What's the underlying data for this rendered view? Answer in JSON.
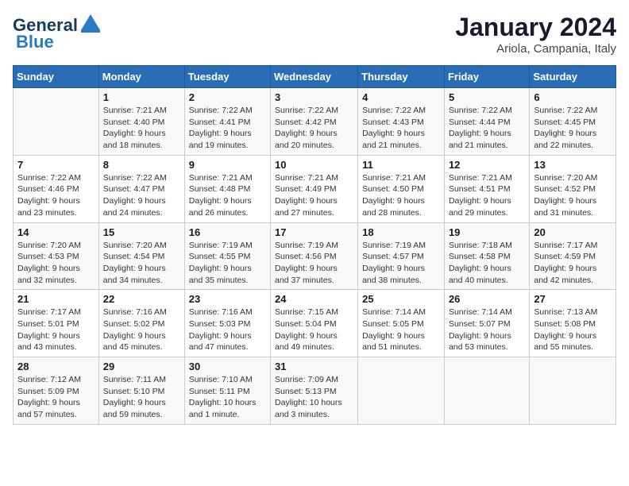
{
  "header": {
    "logo_line1": "General",
    "logo_line2": "Blue",
    "title": "January 2024",
    "subtitle": "Ariola, Campania, Italy"
  },
  "weekdays": [
    "Sunday",
    "Monday",
    "Tuesday",
    "Wednesday",
    "Thursday",
    "Friday",
    "Saturday"
  ],
  "weeks": [
    [
      {
        "date": "",
        "info": ""
      },
      {
        "date": "1",
        "info": "Sunrise: 7:21 AM\nSunset: 4:40 PM\nDaylight: 9 hours\nand 18 minutes."
      },
      {
        "date": "2",
        "info": "Sunrise: 7:22 AM\nSunset: 4:41 PM\nDaylight: 9 hours\nand 19 minutes."
      },
      {
        "date": "3",
        "info": "Sunrise: 7:22 AM\nSunset: 4:42 PM\nDaylight: 9 hours\nand 20 minutes."
      },
      {
        "date": "4",
        "info": "Sunrise: 7:22 AM\nSunset: 4:43 PM\nDaylight: 9 hours\nand 21 minutes."
      },
      {
        "date": "5",
        "info": "Sunrise: 7:22 AM\nSunset: 4:44 PM\nDaylight: 9 hours\nand 21 minutes."
      },
      {
        "date": "6",
        "info": "Sunrise: 7:22 AM\nSunset: 4:45 PM\nDaylight: 9 hours\nand 22 minutes."
      }
    ],
    [
      {
        "date": "7",
        "info": "Sunrise: 7:22 AM\nSunset: 4:46 PM\nDaylight: 9 hours\nand 23 minutes."
      },
      {
        "date": "8",
        "info": "Sunrise: 7:22 AM\nSunset: 4:47 PM\nDaylight: 9 hours\nand 24 minutes."
      },
      {
        "date": "9",
        "info": "Sunrise: 7:21 AM\nSunset: 4:48 PM\nDaylight: 9 hours\nand 26 minutes."
      },
      {
        "date": "10",
        "info": "Sunrise: 7:21 AM\nSunset: 4:49 PM\nDaylight: 9 hours\nand 27 minutes."
      },
      {
        "date": "11",
        "info": "Sunrise: 7:21 AM\nSunset: 4:50 PM\nDaylight: 9 hours\nand 28 minutes."
      },
      {
        "date": "12",
        "info": "Sunrise: 7:21 AM\nSunset: 4:51 PM\nDaylight: 9 hours\nand 29 minutes."
      },
      {
        "date": "13",
        "info": "Sunrise: 7:20 AM\nSunset: 4:52 PM\nDaylight: 9 hours\nand 31 minutes."
      }
    ],
    [
      {
        "date": "14",
        "info": "Sunrise: 7:20 AM\nSunset: 4:53 PM\nDaylight: 9 hours\nand 32 minutes."
      },
      {
        "date": "15",
        "info": "Sunrise: 7:20 AM\nSunset: 4:54 PM\nDaylight: 9 hours\nand 34 minutes."
      },
      {
        "date": "16",
        "info": "Sunrise: 7:19 AM\nSunset: 4:55 PM\nDaylight: 9 hours\nand 35 minutes."
      },
      {
        "date": "17",
        "info": "Sunrise: 7:19 AM\nSunset: 4:56 PM\nDaylight: 9 hours\nand 37 minutes."
      },
      {
        "date": "18",
        "info": "Sunrise: 7:19 AM\nSunset: 4:57 PM\nDaylight: 9 hours\nand 38 minutes."
      },
      {
        "date": "19",
        "info": "Sunrise: 7:18 AM\nSunset: 4:58 PM\nDaylight: 9 hours\nand 40 minutes."
      },
      {
        "date": "20",
        "info": "Sunrise: 7:17 AM\nSunset: 4:59 PM\nDaylight: 9 hours\nand 42 minutes."
      }
    ],
    [
      {
        "date": "21",
        "info": "Sunrise: 7:17 AM\nSunset: 5:01 PM\nDaylight: 9 hours\nand 43 minutes."
      },
      {
        "date": "22",
        "info": "Sunrise: 7:16 AM\nSunset: 5:02 PM\nDaylight: 9 hours\nand 45 minutes."
      },
      {
        "date": "23",
        "info": "Sunrise: 7:16 AM\nSunset: 5:03 PM\nDaylight: 9 hours\nand 47 minutes."
      },
      {
        "date": "24",
        "info": "Sunrise: 7:15 AM\nSunset: 5:04 PM\nDaylight: 9 hours\nand 49 minutes."
      },
      {
        "date": "25",
        "info": "Sunrise: 7:14 AM\nSunset: 5:05 PM\nDaylight: 9 hours\nand 51 minutes."
      },
      {
        "date": "26",
        "info": "Sunrise: 7:14 AM\nSunset: 5:07 PM\nDaylight: 9 hours\nand 53 minutes."
      },
      {
        "date": "27",
        "info": "Sunrise: 7:13 AM\nSunset: 5:08 PM\nDaylight: 9 hours\nand 55 minutes."
      }
    ],
    [
      {
        "date": "28",
        "info": "Sunrise: 7:12 AM\nSunset: 5:09 PM\nDaylight: 9 hours\nand 57 minutes."
      },
      {
        "date": "29",
        "info": "Sunrise: 7:11 AM\nSunset: 5:10 PM\nDaylight: 9 hours\nand 59 minutes."
      },
      {
        "date": "30",
        "info": "Sunrise: 7:10 AM\nSunset: 5:11 PM\nDaylight: 10 hours\nand 1 minute."
      },
      {
        "date": "31",
        "info": "Sunrise: 7:09 AM\nSunset: 5:13 PM\nDaylight: 10 hours\nand 3 minutes."
      },
      {
        "date": "",
        "info": ""
      },
      {
        "date": "",
        "info": ""
      },
      {
        "date": "",
        "info": ""
      }
    ]
  ]
}
